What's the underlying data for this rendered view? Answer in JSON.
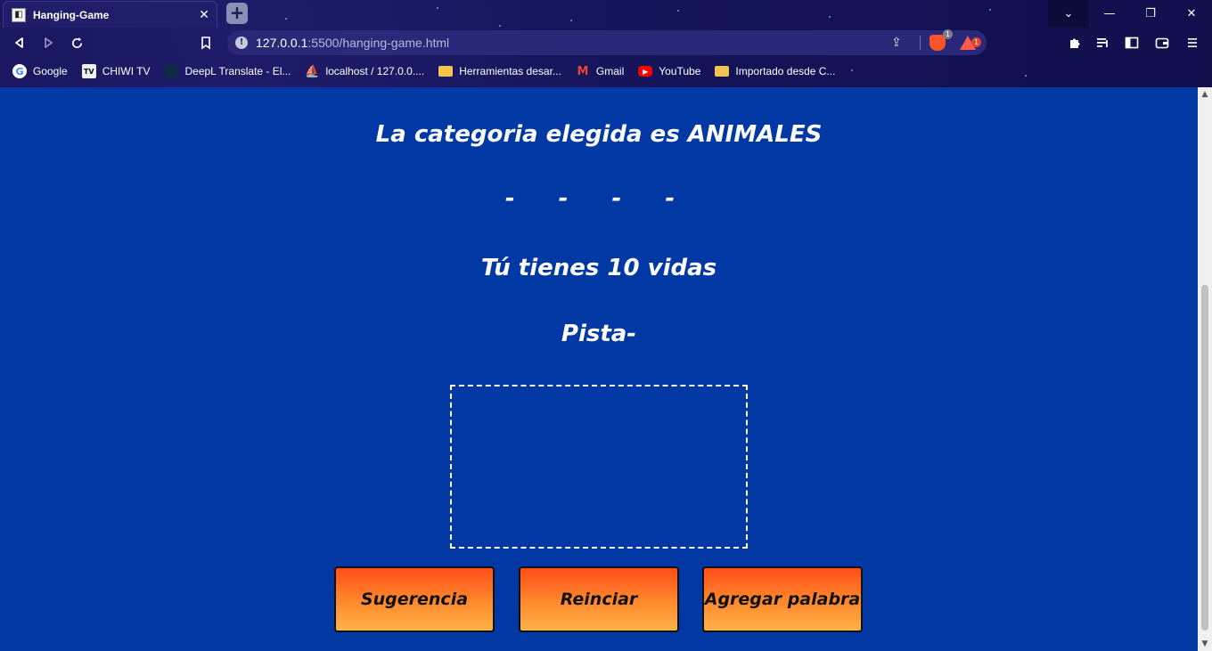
{
  "browser": {
    "tab": {
      "title": "Hanging-Game",
      "close": "✕"
    },
    "new_tab": "+",
    "window_controls": {
      "dropdown": "⌄",
      "minimize": "—",
      "maximize": "❐",
      "close": "✕"
    },
    "address": {
      "host": "127.0.0.1",
      "rest": ":5500/hanging-game.html"
    },
    "brave_badge": "1",
    "rewards_badge": "1",
    "bookmarks": [
      {
        "label": "Google",
        "icon": "google-icon"
      },
      {
        "label": "CHIWI TV",
        "icon": "tv-icon"
      },
      {
        "label": "DeepL Translate - El...",
        "icon": "deepl-icon"
      },
      {
        "label": "localhost / 127.0.0....",
        "icon": "phpmyadmin-icon"
      },
      {
        "label": "Herramientas desar...",
        "icon": "folder-icon"
      },
      {
        "label": "Gmail",
        "icon": "gmail-icon"
      },
      {
        "label": "YouTube",
        "icon": "youtube-icon"
      },
      {
        "label": "Importado desde C...",
        "icon": "folder-icon"
      }
    ]
  },
  "game": {
    "category_text": "La categoria elegida es ANIMALES",
    "word_mask": "- - - -",
    "lives_text": "Tú tienes 10 vidas",
    "hint_text": "Pista-",
    "buttons": {
      "hint": "Sugerencia",
      "restart": "Reinciar",
      "add_word": "Agregar palabra"
    }
  }
}
